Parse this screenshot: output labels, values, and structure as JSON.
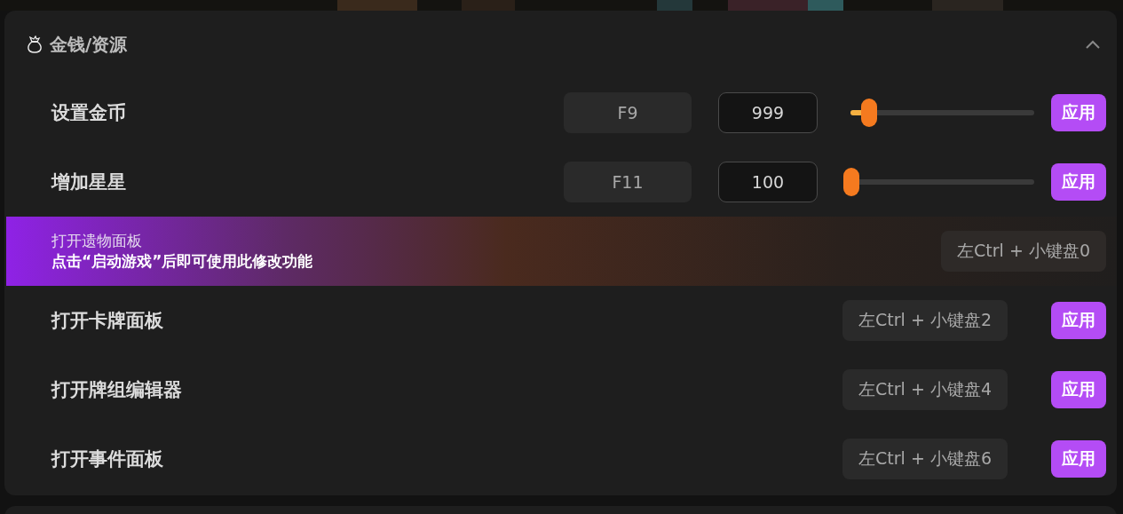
{
  "section": {
    "title": "金钱/资源",
    "expanded": true
  },
  "rows": [
    {
      "kind": "slider",
      "label": "设置金币",
      "hotkey": "F9",
      "value": "999",
      "level": 0.1,
      "apply": "应用"
    },
    {
      "kind": "slider",
      "label": "增加星星",
      "hotkey": "F11",
      "value": "100",
      "level": 0,
      "apply": "应用"
    },
    {
      "kind": "locked",
      "label": "打开遗物面板",
      "notice": "点击“启动游戏”后即可使用此修改功能",
      "shortcut": "左Ctrl + 小键盘0"
    },
    {
      "kind": "shortcut",
      "label": "打开卡牌面板",
      "shortcut": "左Ctrl + 小键盘2",
      "apply": "应用"
    },
    {
      "kind": "shortcut",
      "label": "打开牌组编辑器",
      "shortcut": "左Ctrl + 小键盘4",
      "apply": "应用"
    },
    {
      "kind": "shortcut",
      "label": "打开事件面板",
      "shortcut": "左Ctrl + 小键盘6",
      "apply": "应用"
    }
  ]
}
